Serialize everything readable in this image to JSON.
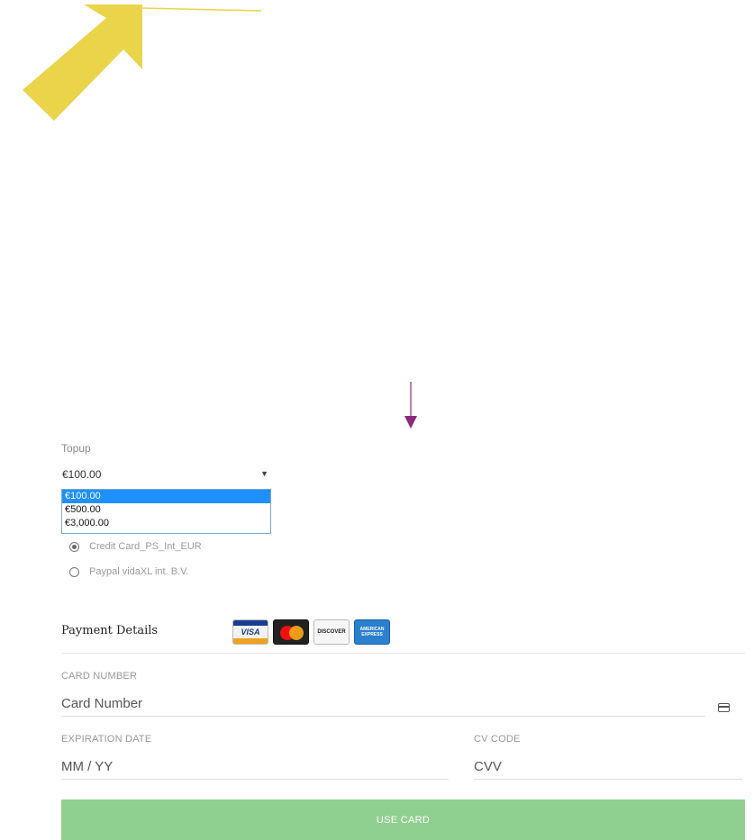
{
  "topup": {
    "label": "Topup",
    "selected_value": "€100.00",
    "options": [
      "€100.00",
      "€500.00",
      "€3,000.00"
    ]
  },
  "payment_methods": [
    {
      "label": "Credit Card_PS_Int_EUR",
      "checked": true
    },
    {
      "label": "Paypal vidaXL int. B.V.",
      "checked": false
    }
  ],
  "payment_details": {
    "title": "Payment Details",
    "card_logos": [
      "visa",
      "mastercard",
      "discover",
      "american-express"
    ],
    "logo_text": {
      "visa": "VISA",
      "discover": "DISCOVER",
      "amex": "AMERICAN EXPRESS"
    }
  },
  "card_number": {
    "label": "CARD NUMBER",
    "placeholder": "Card Number"
  },
  "expiration": {
    "label": "EXPIRATION DATE",
    "placeholder": "MM / YY"
  },
  "cvv": {
    "label": "CV CODE",
    "placeholder": "CVV"
  },
  "submit": {
    "label": "USE CARD"
  },
  "colors": {
    "annotation_yellow": "#e9d44a",
    "annotation_purple": "#8b2a7a",
    "dropdown_highlight": "#1e90ff",
    "button_green": "#8fcf8f"
  }
}
